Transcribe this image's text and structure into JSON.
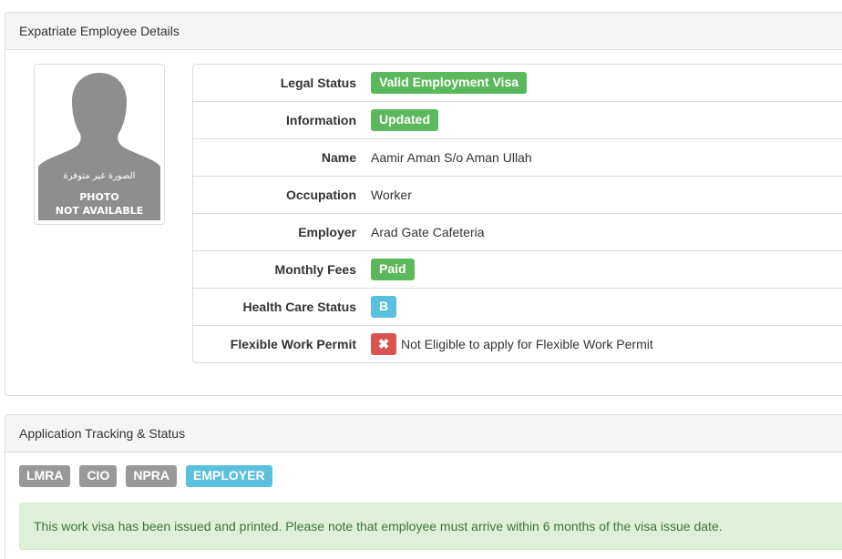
{
  "employee_panel": {
    "title": "Expatriate Employee Details",
    "photo": {
      "arabic_text": "الصورة غير متوفرة",
      "line1": "PHOTO",
      "line2": "NOT AVAILABLE"
    },
    "rows": [
      {
        "label": "Legal Status",
        "value": "Valid Employment Visa",
        "type": "badge",
        "color": "#5cb85c"
      },
      {
        "label": "Information",
        "value": "Updated",
        "type": "badge",
        "color": "#5cb85c"
      },
      {
        "label": "Name",
        "value": "Aamir Aman S/o Aman Ullah",
        "type": "text"
      },
      {
        "label": "Occupation",
        "value": "Worker",
        "type": "text"
      },
      {
        "label": "Employer",
        "value": "Arad Gate Cafeteria",
        "type": "text"
      },
      {
        "label": "Monthly Fees",
        "value": "Paid",
        "type": "badge",
        "color": "#5cb85c"
      },
      {
        "label": "Health Care Status",
        "value": "B",
        "type": "badge",
        "color": "#5bc0de"
      },
      {
        "label": "Flexible Work Permit",
        "value": "Not Eligible to apply for Flexible Work Permit",
        "type": "icon-text",
        "icon": "close-icon",
        "icon_glyph": "✖",
        "color": "#d9534f"
      }
    ]
  },
  "tracking_panel": {
    "title": "Application Tracking & Status",
    "tabs": [
      {
        "label": "LMRA",
        "color": "#999999"
      },
      {
        "label": "CIO",
        "color": "#999999"
      },
      {
        "label": "NPRA",
        "color": "#999999"
      },
      {
        "label": "EMPLOYER",
        "color": "#5bc0de",
        "active": true
      }
    ],
    "alert": "This work visa has been issued and printed. Please note that employee must arrive within 6 months of the visa issue date."
  }
}
